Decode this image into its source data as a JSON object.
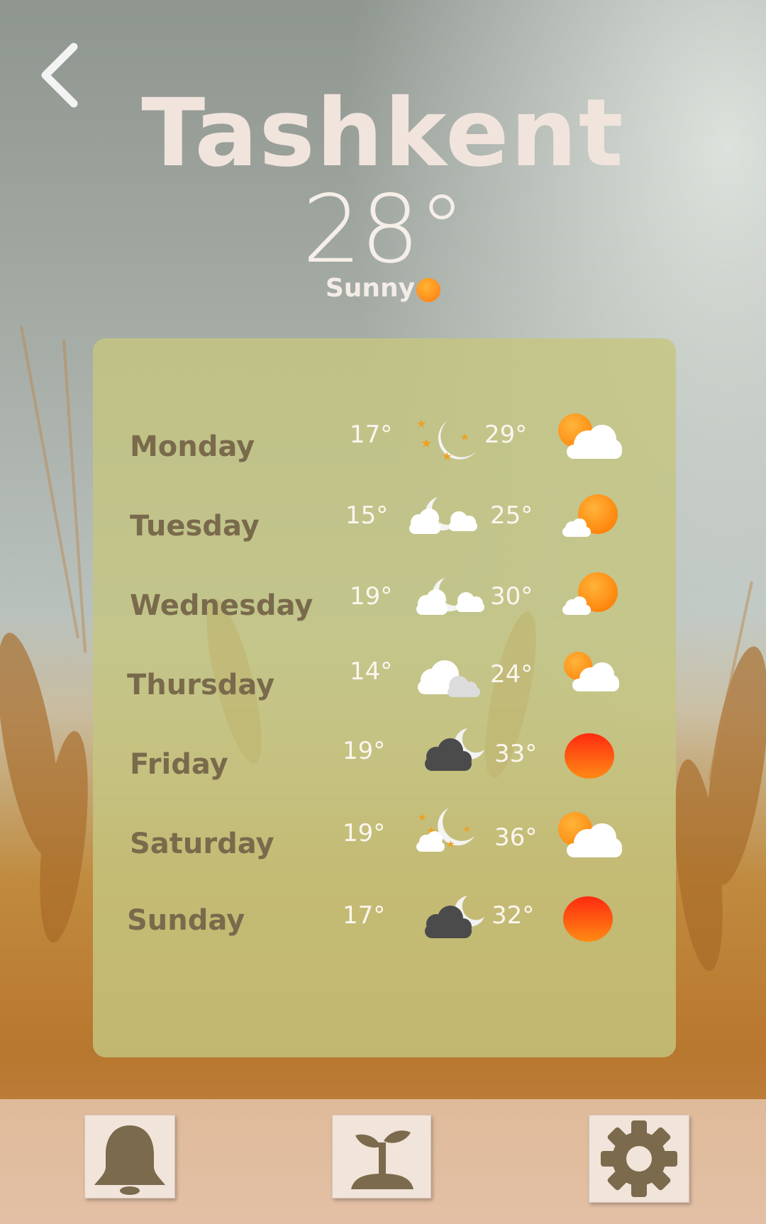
{
  "location": {
    "city": "Tashkent"
  },
  "current": {
    "temperature": "28°",
    "condition": "Sunny",
    "condition_icon": "sun-icon"
  },
  "forecast": [
    {
      "day": "Monday",
      "low": "17°",
      "night_icon": "moon-stars-icon",
      "high": "29°",
      "day_icon": "sun-behind-cloud-icon"
    },
    {
      "day": "Tuesday",
      "low": "15°",
      "night_icon": "moon-clouds-icon",
      "high": "25°",
      "day_icon": "sun-small-cloud-icon"
    },
    {
      "day": "Wednesday",
      "low": "19°",
      "night_icon": "moon-clouds-icon",
      "high": "30°",
      "day_icon": "sun-small-cloud-icon"
    },
    {
      "day": "Thursday",
      "low": "14°",
      "night_icon": "clouds-icon",
      "high": "24°",
      "day_icon": "sun-behind-cloud-icon"
    },
    {
      "day": "Friday",
      "low": "19°",
      "night_icon": "moon-dark-cloud-icon",
      "high": "33°",
      "day_icon": "hot-sun-icon"
    },
    {
      "day": "Saturday",
      "low": "19°",
      "night_icon": "moon-stars-cloud-icon",
      "high": "36°",
      "day_icon": "sun-behind-cloud-icon"
    },
    {
      "day": "Sunday",
      "low": "17°",
      "night_icon": "moon-dark-cloud-icon",
      "high": "32°",
      "day_icon": "hot-sun-icon"
    }
  ],
  "tabbar": {
    "items": [
      "bell-icon",
      "sprout-icon",
      "gear-icon"
    ]
  },
  "colors": {
    "card": "#c4c680",
    "day_text": "#7a6a4c",
    "icon_brown": "#7b6a4c",
    "sun_orange": "#ff8a12",
    "hot_sun_red": "#ff3a10",
    "tab_button": "#f1e4da"
  }
}
